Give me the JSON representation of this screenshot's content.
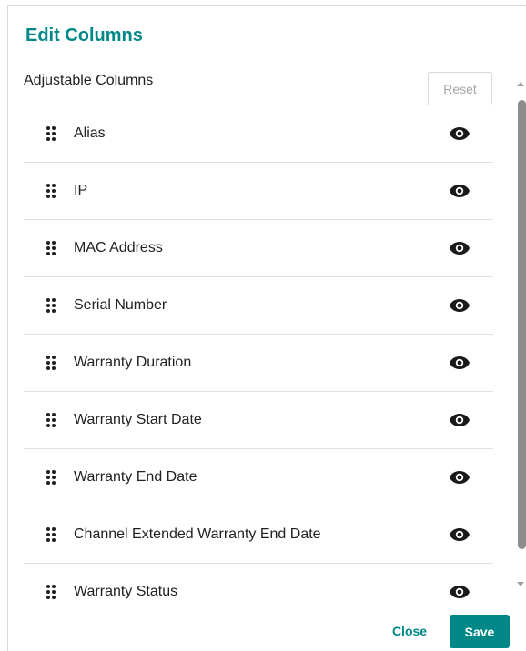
{
  "dialog": {
    "title": "Edit Columns",
    "section_label": "Adjustable Columns",
    "reset_label": "Reset"
  },
  "columns": [
    {
      "label": "Alias",
      "visible_icon": "eye-icon"
    },
    {
      "label": "IP",
      "visible_icon": "eye-icon"
    },
    {
      "label": "MAC Address",
      "visible_icon": "eye-icon"
    },
    {
      "label": "Serial Number",
      "visible_icon": "eye-icon"
    },
    {
      "label": "Warranty Duration",
      "visible_icon": "eye-icon"
    },
    {
      "label": "Warranty Start Date",
      "visible_icon": "eye-icon"
    },
    {
      "label": "Warranty End Date",
      "visible_icon": "eye-icon"
    },
    {
      "label": "Channel Extended Warranty End Date",
      "visible_icon": "eye-icon"
    },
    {
      "label": "Warranty Status",
      "visible_icon": "eye-icon"
    }
  ],
  "footer": {
    "close_label": "Close",
    "save_label": "Save"
  },
  "colors": {
    "accent": "#008787",
    "text": "#212121",
    "disabled_text": "#a6a6a6",
    "divider": "#e0e0e0"
  }
}
